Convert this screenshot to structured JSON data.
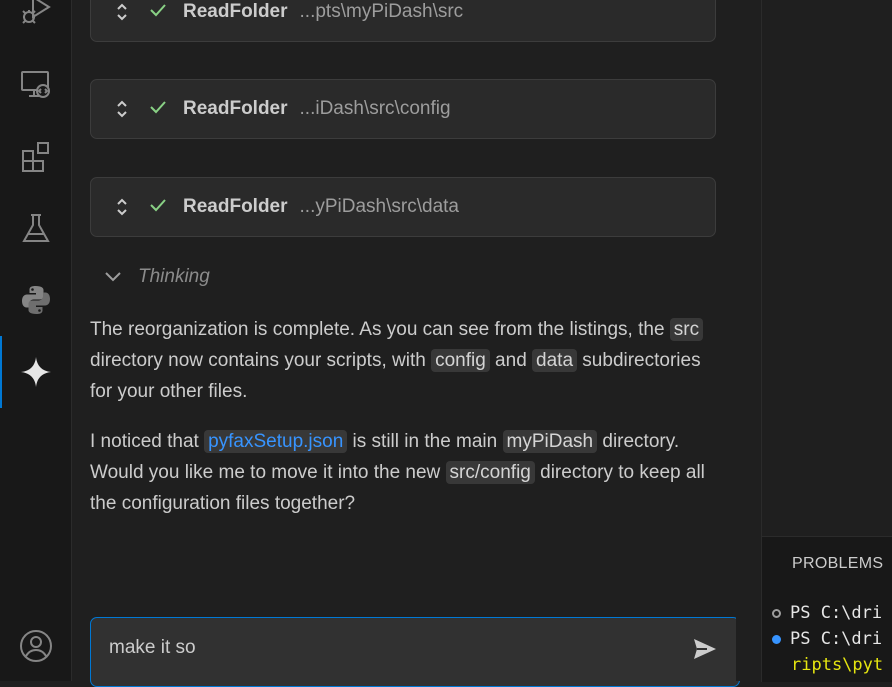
{
  "activity_bar": {
    "icons": [
      "run-debug-icon",
      "remote-explorer-icon",
      "extensions-icon",
      "testing-icon",
      "python-icon",
      "gemini-sparkle-icon",
      "account-icon"
    ],
    "active_color": "#0078d4"
  },
  "chat": {
    "tools": [
      {
        "name": "ReadFolder",
        "path": "...pts\\myPiDash\\src"
      },
      {
        "name": "ReadFolder",
        "path": "...iDash\\src\\config"
      },
      {
        "name": "ReadFolder",
        "path": "...yPiDash\\src\\data"
      }
    ],
    "thinking_label": "Thinking",
    "para1": {
      "t1": "The reorganization is complete. As you can see from the listings, the ",
      "c1": "src",
      "t2": " directory now contains your scripts, with ",
      "c2": "config",
      "t3": " and ",
      "c3": "data",
      "t4": " subdirectories for your other files."
    },
    "para2": {
      "t1": "I noticed that ",
      "link": "pyfaxSetup.json",
      "t2": " is still in the main ",
      "c1": "myPiDash",
      "t3": " directory. Would you like me to move it into the new ",
      "c2": "src/config",
      "t4": " directory to keep all the configuration files together?"
    },
    "input_value": "make it so"
  },
  "panel": {
    "title": "PROBLEMS",
    "lines": [
      {
        "text": "PS C:\\dri",
        "dot": "hollow"
      },
      {
        "text": "PS C:\\dri",
        "dot": "blue"
      },
      {
        "text": "ripts\\pyt",
        "dot": "none"
      }
    ]
  },
  "colors": {
    "accent": "#0078d4",
    "link": "#3794ff",
    "check": "#89d185",
    "terminal_yellow": "#e5e510"
  }
}
